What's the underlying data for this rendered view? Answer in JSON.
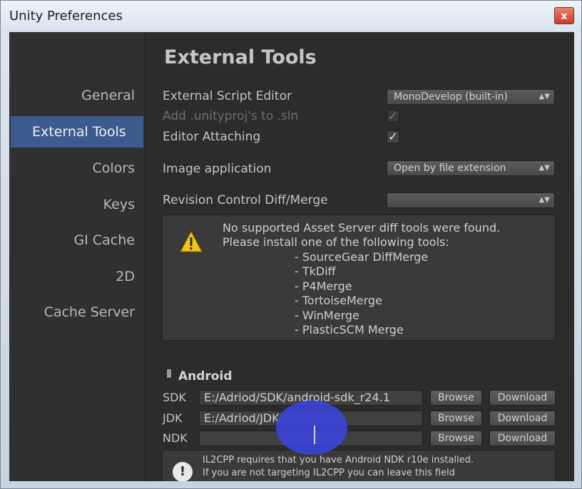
{
  "window": {
    "title": "Unity Preferences",
    "close_label": "x"
  },
  "sidebar": {
    "items": [
      {
        "label": "General",
        "active": false
      },
      {
        "label": "External Tools",
        "active": true
      },
      {
        "label": "Colors",
        "active": false
      },
      {
        "label": "Keys",
        "active": false
      },
      {
        "label": "GI Cache",
        "active": false
      },
      {
        "label": "2D",
        "active": false
      },
      {
        "label": "Cache Server",
        "active": false
      }
    ]
  },
  "main": {
    "heading": "External Tools",
    "external_script_editor": {
      "label": "External Script Editor",
      "value": "MonoDevelop (built-in)"
    },
    "add_unityproj": {
      "label": "Add .unityproj's to .sln",
      "checked": true,
      "disabled": true
    },
    "editor_attaching": {
      "label": "Editor Attaching",
      "checked": true
    },
    "image_application": {
      "label": "Image application",
      "value": "Open by file extension"
    },
    "revision_control": {
      "label": "Revision Control Diff/Merge",
      "value": ""
    },
    "help": {
      "line1": "No supported Asset Server diff tools were found.",
      "line2": "Please install one of the following tools:",
      "tools": [
        "- SourceGear DiffMerge",
        "- TkDiff",
        "- P4Merge",
        "- TortoiseMerge",
        "- WinMerge",
        "- PlasticSCM Merge"
      ]
    },
    "android": {
      "title": "Android",
      "sdk": {
        "label": "SDK",
        "value": "E:/Adriod/SDK/android-sdk_r24.1"
      },
      "jdk": {
        "label": "JDK",
        "value": "E:/Adriod/JDK"
      },
      "ndk": {
        "label": "NDK",
        "value": ""
      },
      "browse_label": "Browse",
      "download_label": "Download",
      "note_line1": "IL2CPP requires that you have Android NDK r10e installed.",
      "note_line2": "If you are not targeting IL2CPP you can leave this field"
    }
  },
  "colors": {
    "accent": "#3c5b8f",
    "panel": "#2c2c2c",
    "cursor_halo": "#3c46eb"
  }
}
